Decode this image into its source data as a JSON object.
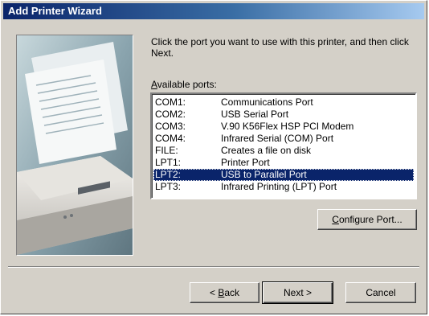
{
  "window": {
    "title": "Add Printer Wizard"
  },
  "instruction": "Click the port you want to use with this printer, and then click Next.",
  "ports_label": {
    "accel": "A",
    "rest": "vailable ports:"
  },
  "ports": [
    {
      "port": "COM1:",
      "description": "Communications Port"
    },
    {
      "port": "COM2:",
      "description": "USB Serial Port"
    },
    {
      "port": "COM3:",
      "description": "V.90 K56Flex HSP PCI Modem"
    },
    {
      "port": "COM4:",
      "description": "Infrared Serial (COM) Port"
    },
    {
      "port": "FILE:",
      "description": "Creates a file on disk"
    },
    {
      "port": "LPT1:",
      "description": "Printer Port"
    },
    {
      "port": "LPT2:",
      "description": "USB to Parallel Port"
    },
    {
      "port": "LPT3:",
      "description": "Infrared Printing (LPT) Port"
    }
  ],
  "selected_port": "LPT2:",
  "buttons": {
    "configure": {
      "accel": "C",
      "rest": "onfigure Port..."
    },
    "back": {
      "prefix": "< ",
      "accel": "B",
      "rest": "ack"
    },
    "next": "Next >",
    "cancel": "Cancel"
  },
  "colors": {
    "title_active": "#0a246a",
    "title_gradient_end": "#a6caf0",
    "face": "#d4d0c8",
    "selection": "#0a246a"
  }
}
